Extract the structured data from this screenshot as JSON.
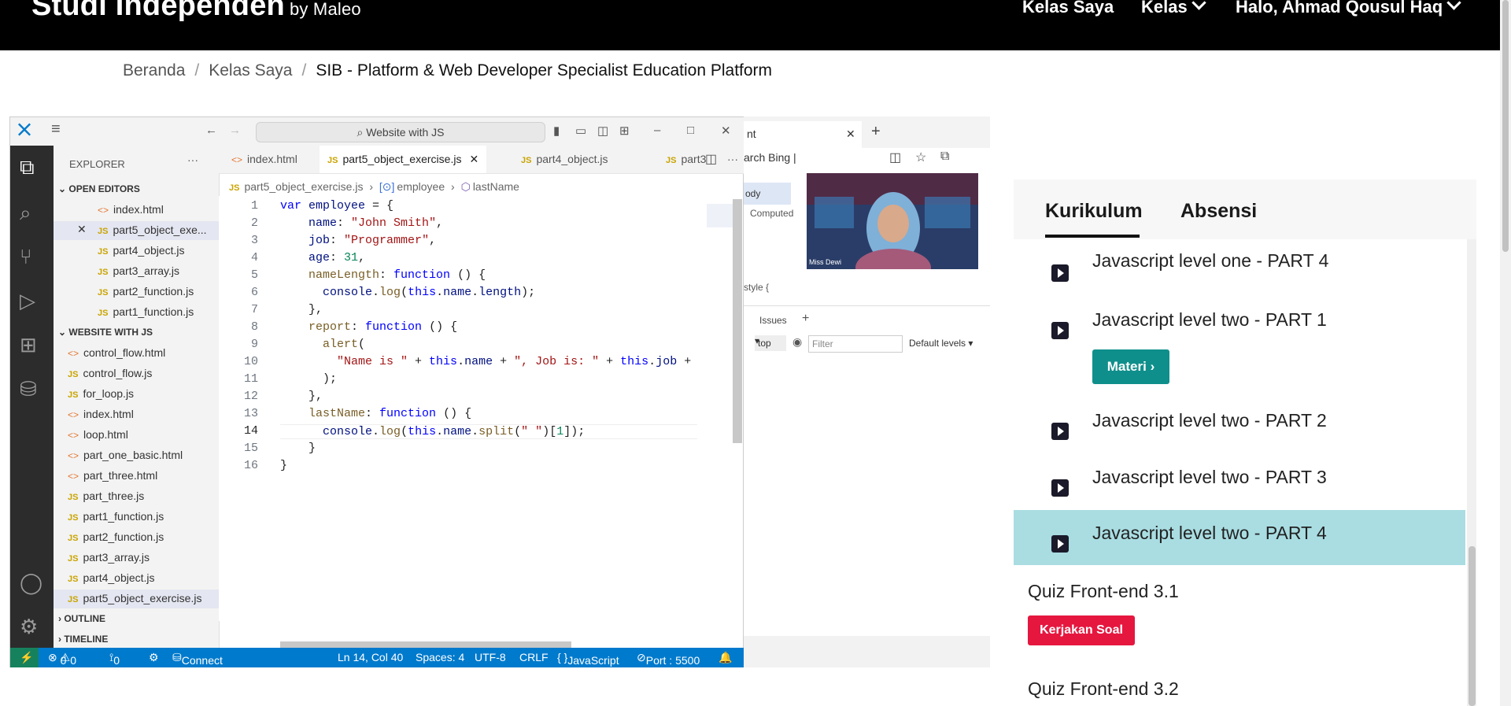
{
  "nav": {
    "brand": "Studi Independen",
    "brand_sub": "by Maleo",
    "links": [
      "Kelas Saya",
      "Kelas",
      "Halo, Ahmad Qousul Haq"
    ]
  },
  "breadcrumb": [
    "Beranda",
    "Kelas Saya",
    "SIB - Platform & Web Developer Specialist Education Platform"
  ],
  "vscode": {
    "search": "Website with JS",
    "explorer_title": "EXPLORER",
    "open_editors_title": "OPEN EDITORS",
    "open_editors": [
      "index.html",
      "part5_object_exe...",
      "part4_object.js",
      "part3_array.js",
      "part2_function.js",
      "part1_function.js"
    ],
    "project_title": "WEBSITE WITH JS",
    "project_files": [
      "control_flow.html",
      "control_flow.js",
      "for_loop.js",
      "index.html",
      "loop.html",
      "part_one_basic.html",
      "part_three.html",
      "part_three.js",
      "part1_function.js",
      "part2_function.js",
      "part3_array.js",
      "part4_object.js",
      "part5_object_exercise.js"
    ],
    "outline": "OUTLINE",
    "timeline": "TIMELINE",
    "tabs": [
      "index.html",
      "part5_object_exercise.js",
      "part4_object.js",
      "part3"
    ],
    "editor_breadcrumb": [
      "part5_object_exercise.js",
      "employee",
      "lastName"
    ],
    "code": [
      "var employee = {",
      "  name: \"John Smith\",",
      "  job: \"Programmer\",",
      "  age: 31,",
      "  nameLength: function () {",
      "    console.log(this.name.length);",
      "  },",
      "  report: function () {",
      "    alert(",
      "      \"Name is \" + this.name + \", Job is: \" + this.job +",
      "    );",
      "  },",
      "  lastName: function () {",
      "    console.log(this.name.split(\" \")[1]);",
      "  }",
      "}"
    ],
    "status": {
      "errors": "0",
      "warnings": "0",
      "ports": "0",
      "connect": "Connect",
      "position": "Ln 14, Col 40",
      "spaces": "Spaces: 4",
      "encoding": "UTF-8",
      "eol": "CRLF",
      "language": "JavaScript",
      "port": "Port : 5500"
    }
  },
  "browser": {
    "tab_label": "nt",
    "search_label": "arch Bing",
    "devtools_computed": "Computed",
    "devtools_body": "ody",
    "devtools_style": "style {",
    "devtools_issues": "Issues",
    "devtools_top": "top",
    "devtools_filter": "Filter",
    "devtools_levels": "Default levels",
    "facecam_label": "Miss Dewi"
  },
  "curriculum": {
    "tabs": [
      "Kurikulum",
      "Absensi"
    ],
    "items": [
      {
        "title": "Javascript level one - PART 4"
      },
      {
        "title": "Javascript level two - PART 1",
        "button": "Materi"
      },
      {
        "title": "Javascript level two - PART 2"
      },
      {
        "title": "Javascript level two - PART 3"
      },
      {
        "title": "Javascript level two - PART 4",
        "selected": true
      }
    ],
    "quizzes": [
      {
        "title": "Quiz Front-end 3.1",
        "button": "Kerjakan Soal"
      },
      {
        "title": "Quiz Front-end 3.2"
      }
    ]
  }
}
